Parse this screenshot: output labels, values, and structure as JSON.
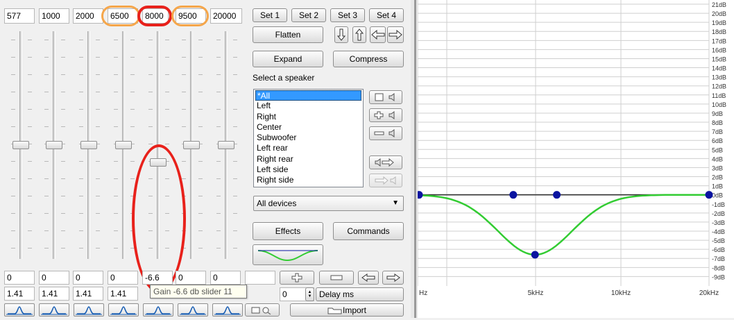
{
  "frequencies": [
    "577",
    "1000",
    "2000",
    "6500",
    "8000",
    "9500",
    "20000"
  ],
  "gain_values": [
    "0",
    "0",
    "0",
    "0",
    "-6.6",
    "0",
    "0"
  ],
  "q_values": [
    "1.41",
    "1.41",
    "1.41",
    "1.41",
    "",
    "",
    ""
  ],
  "slider_gains_db": [
    0,
    0,
    0,
    0,
    -6.6,
    0,
    0
  ],
  "tooltip": "Gain -6.6 db slider 11",
  "set_buttons": [
    "Set 1",
    "Set 2",
    "Set 3",
    "Set 4"
  ],
  "buttons": {
    "flatten": "Flatten",
    "expand": "Expand",
    "compress": "Compress",
    "effects": "Effects",
    "commands": "Commands",
    "import": "Import"
  },
  "select_speaker_label": "Select a speaker",
  "speakers": [
    "*All",
    "Left",
    "Right",
    "Center",
    "Subwoofer",
    "Left rear",
    "Right rear",
    "Left side",
    "Right side"
  ],
  "selected_speaker": "*All",
  "device_select": "All devices",
  "delay": {
    "value": "0",
    "label": "Delay ms"
  },
  "colors": {
    "highlight_orange": "#f5a64a",
    "highlight_red": "#e8211b",
    "curve": "#33cc33",
    "node": "#0a14a0",
    "selection": "#3399ff"
  },
  "graph": {
    "x_labels": [
      "Hz",
      "5kHz",
      "10kHz",
      "20kHz"
    ],
    "db_labels": [
      "21dB",
      "20dB",
      "19dB",
      "18dB",
      "17dB",
      "16dB",
      "15dB",
      "14dB",
      "13dB",
      "12dB",
      "11dB",
      "10dB",
      "9dB",
      "8dB",
      "7dB",
      "6dB",
      "5dB",
      "4dB",
      "3dB",
      "2dB",
      "1dB",
      "0dB",
      "-1dB",
      "-2dB",
      "-3dB",
      "-4dB",
      "-5dB",
      "-6dB",
      "-7dB",
      "-8dB",
      "-9dB"
    ]
  }
}
